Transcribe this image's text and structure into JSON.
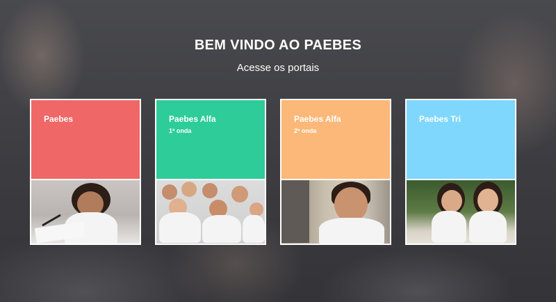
{
  "header": {
    "title": "BEM VINDO AO PAEBES",
    "subtitle": "Acesse os portais"
  },
  "cards": [
    {
      "title": "Paebes",
      "sub": "",
      "color": "#f06767",
      "photo": "girl-writing-photo"
    },
    {
      "title": "Paebes Alfa",
      "sub": "1ª onda",
      "color": "#2ecc98",
      "photo": "group-of-kids-photo"
    },
    {
      "title": "Paebes Alfa",
      "sub": "2ª onda",
      "color": "#fbb879",
      "photo": "smiling-boy-photo"
    },
    {
      "title": "Paebes Tri",
      "sub": "",
      "color": "#7fd7fd",
      "photo": "two-girls-photo"
    }
  ]
}
